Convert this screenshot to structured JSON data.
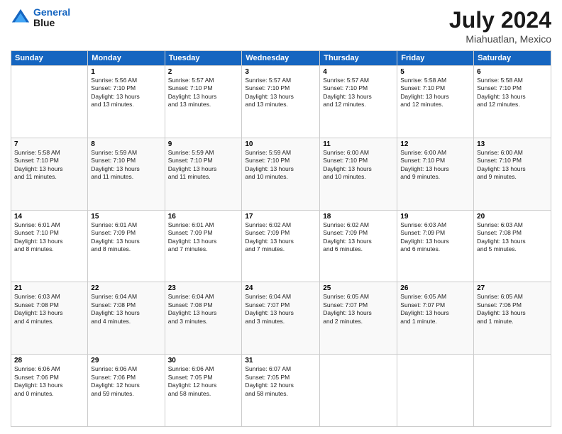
{
  "header": {
    "logo_line1": "General",
    "logo_line2": "Blue",
    "title": "July 2024",
    "subtitle": "Miahuatlan, Mexico"
  },
  "calendar": {
    "days_of_week": [
      "Sunday",
      "Monday",
      "Tuesday",
      "Wednesday",
      "Thursday",
      "Friday",
      "Saturday"
    ],
    "weeks": [
      [
        {
          "day": "",
          "info": ""
        },
        {
          "day": "1",
          "info": "Sunrise: 5:56 AM\nSunset: 7:10 PM\nDaylight: 13 hours\nand 13 minutes."
        },
        {
          "day": "2",
          "info": "Sunrise: 5:57 AM\nSunset: 7:10 PM\nDaylight: 13 hours\nand 13 minutes."
        },
        {
          "day": "3",
          "info": "Sunrise: 5:57 AM\nSunset: 7:10 PM\nDaylight: 13 hours\nand 13 minutes."
        },
        {
          "day": "4",
          "info": "Sunrise: 5:57 AM\nSunset: 7:10 PM\nDaylight: 13 hours\nand 12 minutes."
        },
        {
          "day": "5",
          "info": "Sunrise: 5:58 AM\nSunset: 7:10 PM\nDaylight: 13 hours\nand 12 minutes."
        },
        {
          "day": "6",
          "info": "Sunrise: 5:58 AM\nSunset: 7:10 PM\nDaylight: 13 hours\nand 12 minutes."
        }
      ],
      [
        {
          "day": "7",
          "info": "Sunrise: 5:58 AM\nSunset: 7:10 PM\nDaylight: 13 hours\nand 11 minutes."
        },
        {
          "day": "8",
          "info": "Sunrise: 5:59 AM\nSunset: 7:10 PM\nDaylight: 13 hours\nand 11 minutes."
        },
        {
          "day": "9",
          "info": "Sunrise: 5:59 AM\nSunset: 7:10 PM\nDaylight: 13 hours\nand 11 minutes."
        },
        {
          "day": "10",
          "info": "Sunrise: 5:59 AM\nSunset: 7:10 PM\nDaylight: 13 hours\nand 10 minutes."
        },
        {
          "day": "11",
          "info": "Sunrise: 6:00 AM\nSunset: 7:10 PM\nDaylight: 13 hours\nand 10 minutes."
        },
        {
          "day": "12",
          "info": "Sunrise: 6:00 AM\nSunset: 7:10 PM\nDaylight: 13 hours\nand 9 minutes."
        },
        {
          "day": "13",
          "info": "Sunrise: 6:00 AM\nSunset: 7:10 PM\nDaylight: 13 hours\nand 9 minutes."
        }
      ],
      [
        {
          "day": "14",
          "info": "Sunrise: 6:01 AM\nSunset: 7:10 PM\nDaylight: 13 hours\nand 8 minutes."
        },
        {
          "day": "15",
          "info": "Sunrise: 6:01 AM\nSunset: 7:09 PM\nDaylight: 13 hours\nand 8 minutes."
        },
        {
          "day": "16",
          "info": "Sunrise: 6:01 AM\nSunset: 7:09 PM\nDaylight: 13 hours\nand 7 minutes."
        },
        {
          "day": "17",
          "info": "Sunrise: 6:02 AM\nSunset: 7:09 PM\nDaylight: 13 hours\nand 7 minutes."
        },
        {
          "day": "18",
          "info": "Sunrise: 6:02 AM\nSunset: 7:09 PM\nDaylight: 13 hours\nand 6 minutes."
        },
        {
          "day": "19",
          "info": "Sunrise: 6:03 AM\nSunset: 7:09 PM\nDaylight: 13 hours\nand 6 minutes."
        },
        {
          "day": "20",
          "info": "Sunrise: 6:03 AM\nSunset: 7:08 PM\nDaylight: 13 hours\nand 5 minutes."
        }
      ],
      [
        {
          "day": "21",
          "info": "Sunrise: 6:03 AM\nSunset: 7:08 PM\nDaylight: 13 hours\nand 4 minutes."
        },
        {
          "day": "22",
          "info": "Sunrise: 6:04 AM\nSunset: 7:08 PM\nDaylight: 13 hours\nand 4 minutes."
        },
        {
          "day": "23",
          "info": "Sunrise: 6:04 AM\nSunset: 7:08 PM\nDaylight: 13 hours\nand 3 minutes."
        },
        {
          "day": "24",
          "info": "Sunrise: 6:04 AM\nSunset: 7:07 PM\nDaylight: 13 hours\nand 3 minutes."
        },
        {
          "day": "25",
          "info": "Sunrise: 6:05 AM\nSunset: 7:07 PM\nDaylight: 13 hours\nand 2 minutes."
        },
        {
          "day": "26",
          "info": "Sunrise: 6:05 AM\nSunset: 7:07 PM\nDaylight: 13 hours\nand 1 minute."
        },
        {
          "day": "27",
          "info": "Sunrise: 6:05 AM\nSunset: 7:06 PM\nDaylight: 13 hours\nand 1 minute."
        }
      ],
      [
        {
          "day": "28",
          "info": "Sunrise: 6:06 AM\nSunset: 7:06 PM\nDaylight: 13 hours\nand 0 minutes."
        },
        {
          "day": "29",
          "info": "Sunrise: 6:06 AM\nSunset: 7:06 PM\nDaylight: 12 hours\nand 59 minutes."
        },
        {
          "day": "30",
          "info": "Sunrise: 6:06 AM\nSunset: 7:05 PM\nDaylight: 12 hours\nand 58 minutes."
        },
        {
          "day": "31",
          "info": "Sunrise: 6:07 AM\nSunset: 7:05 PM\nDaylight: 12 hours\nand 58 minutes."
        },
        {
          "day": "",
          "info": ""
        },
        {
          "day": "",
          "info": ""
        },
        {
          "day": "",
          "info": ""
        }
      ]
    ]
  }
}
